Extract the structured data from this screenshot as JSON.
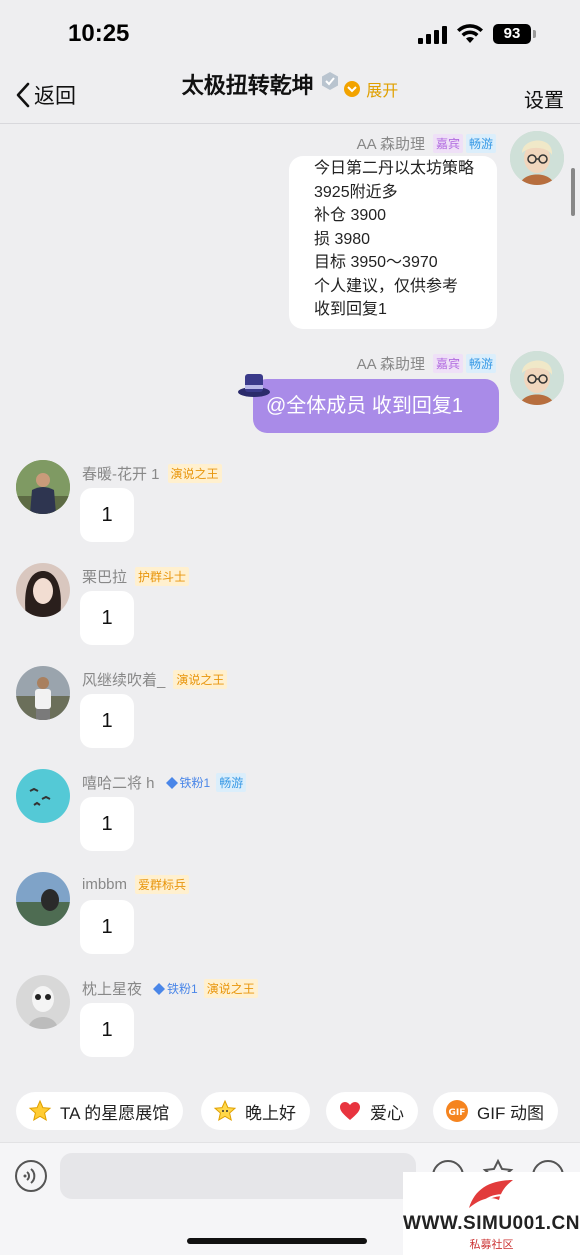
{
  "status_bar": {
    "time": "10:25",
    "battery": "93"
  },
  "nav": {
    "back_label": "返回",
    "title": "太极扭转乾坤",
    "expand_label": "展开",
    "settings_label": "设置"
  },
  "bot_messages": [
    {
      "sender": "AA 森助理",
      "tags": [
        "嘉宾",
        "畅游"
      ],
      "lines": [
        "今日第二丹以太坊策略",
        "3925附近多",
        "补仓 3900",
        "损 3980",
        "目标 3950～3970",
        "个人建议，仅供参考",
        "收到回复1"
      ]
    },
    {
      "sender": "AA 森助理",
      "tags": [
        "嘉宾",
        "畅游"
      ],
      "text": "@全体成员 收到回复1"
    }
  ],
  "member_messages": [
    {
      "name": "春暖-花开 1",
      "tags": [
        "演说之王"
      ],
      "text": "1"
    },
    {
      "name": "栗巴拉",
      "tags": [
        "护群斗士"
      ],
      "text": "1"
    },
    {
      "name": "风继续吹着_",
      "tags": [
        "演说之王"
      ],
      "text": "1"
    },
    {
      "name": "嘻哈二将 h",
      "tags": [
        "铁粉1",
        "畅游"
      ],
      "text": "1"
    },
    {
      "name": "imbbm",
      "tags": [
        "爱群标兵"
      ],
      "text": "1"
    },
    {
      "name": "枕上星夜",
      "tags": [
        "铁粉1",
        "演说之王"
      ],
      "text": "1"
    }
  ],
  "quick_actions": [
    {
      "label": "TA 的星愿展馆",
      "icon": "star-icon"
    },
    {
      "label": "晚上好",
      "icon": "smile-star-icon"
    },
    {
      "label": "爱心",
      "icon": "heart-icon"
    },
    {
      "label": "GIF 动图",
      "icon": "gif-icon"
    }
  ],
  "watermark": {
    "text": "WWW.SIMU001.CN",
    "sub": "私募社区"
  },
  "colors": {
    "purple_bubble": "#a98be8",
    "accent_orange": "#f2a300",
    "background": "#eeeef0"
  }
}
